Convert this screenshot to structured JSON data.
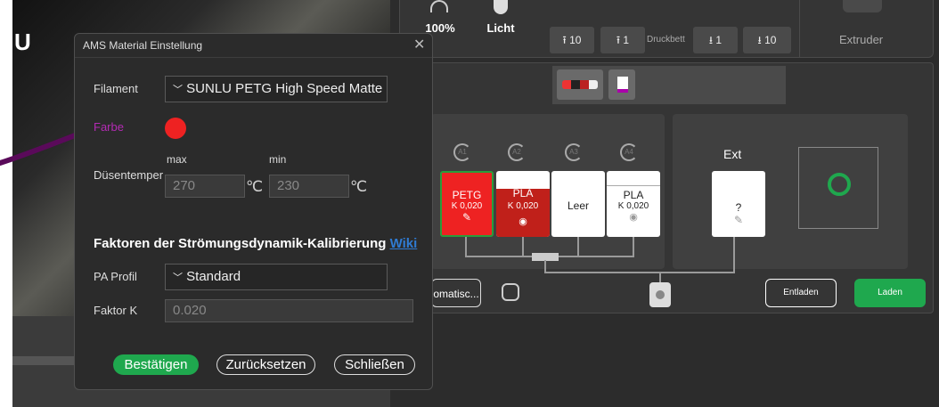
{
  "camera": {
    "logo_fragment": "U"
  },
  "top_bar": {
    "speed": "100%",
    "light_label": "Licht",
    "bed_label": "Druckbett",
    "jog_buttons": [
      "10",
      "1",
      "1",
      "10"
    ],
    "extruder_label": "Extruder"
  },
  "ams": {
    "auto_label": "A",
    "slots": [
      {
        "id": "A1",
        "type": "PETG",
        "k": "K 0,020",
        "color": "#ee2222",
        "icon": "pencil-icon"
      },
      {
        "id": "A2",
        "type": "PLA",
        "k": "K 0,020",
        "color": "#c0201a",
        "icon": "eye-icon"
      },
      {
        "id": "A3",
        "type": "Leer",
        "k": "",
        "color": "#ffffff",
        "icon": ""
      },
      {
        "id": "A4",
        "type": "PLA",
        "k": "K 0,020",
        "color": "#ffffff",
        "icon": "eye-icon"
      }
    ],
    "ext": {
      "title": "Ext",
      "value": "?"
    },
    "auto_button": "omatisc...",
    "unload_button": "Entladen",
    "load_button": "Laden"
  },
  "dialog": {
    "title": "AMS Material Einstellung",
    "filament_label": "Filament",
    "filament_value": "SUNLU PETG High Speed Matte",
    "color_label": "Farbe",
    "color_value": "#ee2222",
    "nozzle_label": "Düsentemper",
    "max_label": "max",
    "min_label": "min",
    "max_value": "270",
    "min_value": "230",
    "unit": "℃",
    "section_title": "Faktoren der Strömungsdynamik-Kalibrierung",
    "wiki_link": "Wiki",
    "pa_profile_label": "PA Profil",
    "pa_profile_value": "Standard",
    "factor_k_label": "Faktor K",
    "factor_k_value": "0.020",
    "confirm_button": "Bestätigen",
    "reset_button": "Zurücksetzen",
    "close_button": "Schließen"
  },
  "colors": {
    "accent_green": "#1fa84e",
    "annotation_purple": "#5a0a5a"
  }
}
